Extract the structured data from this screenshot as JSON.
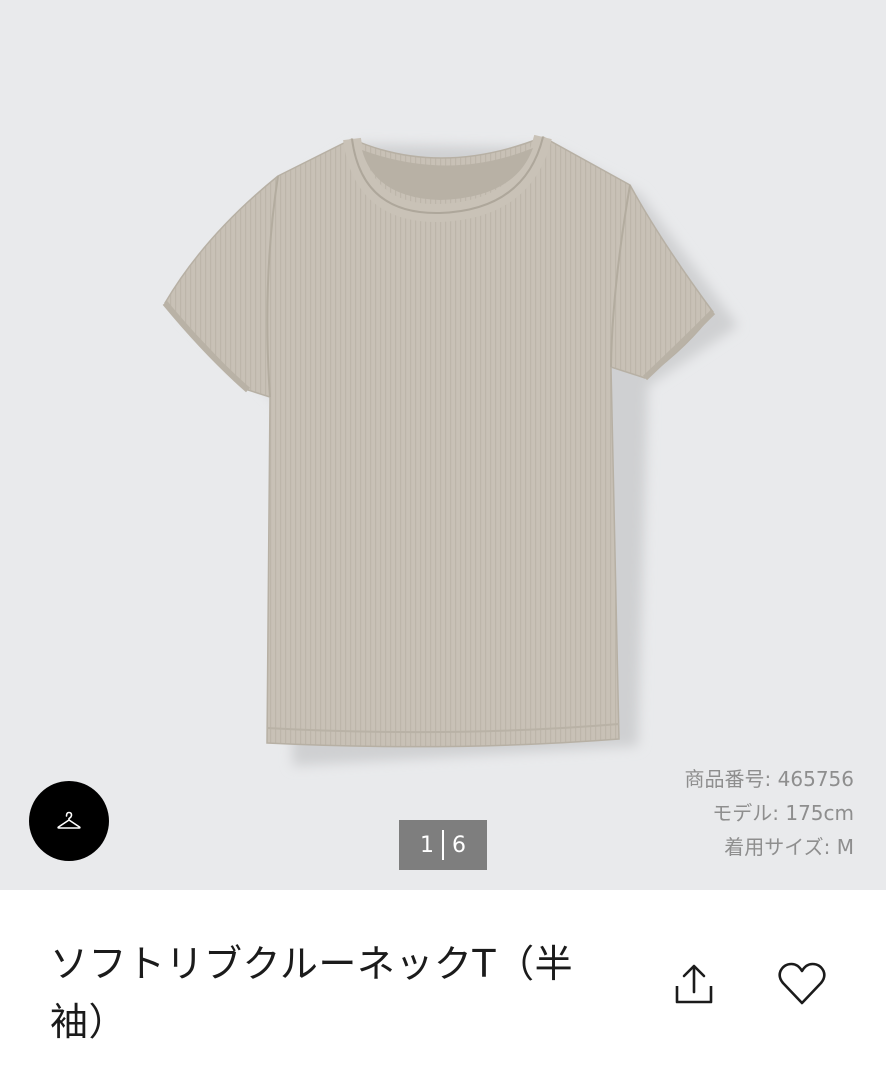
{
  "product": {
    "title": "ソフトリブクルーネックT（半袖）",
    "image_alt": "beige ribbed short-sleeve crew neck t-shirt",
    "product_color": "#c8c1b6"
  },
  "image_counter": {
    "current": "1",
    "total": "6"
  },
  "info": {
    "product_number": "商品番号:  465756",
    "model_height": "モデル: 175cm",
    "size_worn": "着用サイズ: M"
  },
  "icons": {
    "fab": "hanger-icon",
    "share": "share-icon",
    "favorite": "heart-icon"
  },
  "colors": {
    "gallery_bg": "#e9eaec",
    "counter_bg": "#7e7e7e",
    "fab_bg": "#000000",
    "info_text": "#8e8e8e"
  }
}
